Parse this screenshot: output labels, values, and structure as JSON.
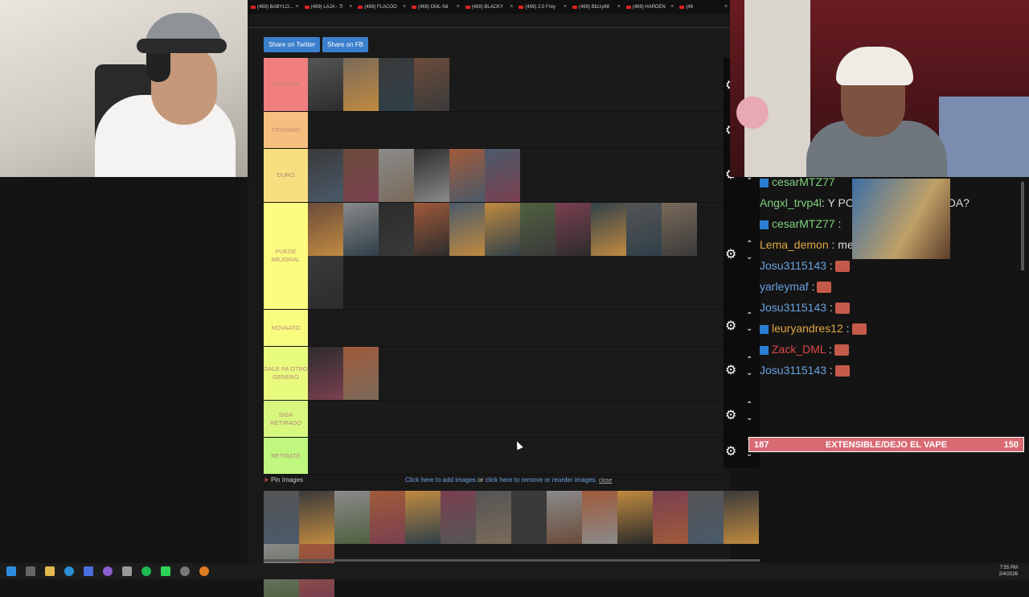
{
  "browser": {
    "tabs": [
      "(469) BABYLO...",
      "(469) LAJA - 7l",
      "(469) FLACOO",
      "(469) DML-Nil",
      "(469) BLACKY",
      "(469) 2.0 Frey",
      "(469) Blizzy68",
      "(469) HARDEN",
      "(46"
    ],
    "share_twitter": "Share on Twitter",
    "share_fb": "Share on FB"
  },
  "tiers": [
    {
      "label": "LEYENDA",
      "color": "#f27f7f",
      "thumb_count": 4
    },
    {
      "label": "TRYHARD",
      "color": "#f7bf7f",
      "thumb_count": 0
    },
    {
      "label": "DURO",
      "color": "#f7df7f",
      "thumb_count": 6
    },
    {
      "label": "PUEDE MEJORAL",
      "color": "#fcfc7f",
      "thumb_count": 12
    },
    {
      "label": "NOVAATO",
      "color": "#f7fc7f",
      "thumb_count": 0
    },
    {
      "label": "DALE PA OTRO GENERO",
      "color": "#e9fb7f",
      "thumb_count": 2
    },
    {
      "label": "SIGA RETIRADO",
      "color": "#d7f77f",
      "thumb_count": 0
    },
    {
      "label": "RETIRATE",
      "color": "#bff77f",
      "thumb_count": 0
    }
  ],
  "pin": {
    "label": "Pin Images",
    "link_add": "Click here to add images",
    "or": " or ",
    "link_remove": "click here to remove or reorder images.",
    "close": "close",
    "thumb_count": 16
  },
  "chat": [
    {
      "user": "cesarMTZ77",
      "text": "",
      "color": "#7fd17f",
      "badge": true,
      "emote": false
    },
    {
      "user": "Angxl_trvp4l",
      "text": ": Y POR ESO ES LEYENDA?",
      "color": "#7fd17f",
      "badge": false,
      "emote": false
    },
    {
      "user": "cesarMTZ77",
      "text": " :",
      "color": "#7fd17f",
      "badge": true,
      "emote": false
    },
    {
      "user": "Lema_demon",
      "text": " : memo o omega?",
      "color": "#e0a642",
      "badge": false,
      "emote": false
    },
    {
      "user": "Josu3115143",
      "text": " :",
      "color": "#6aa2e0",
      "badge": false,
      "emote": true
    },
    {
      "user": "yarleymaf",
      "text": " :",
      "color": "#6aa2e0",
      "badge": false,
      "emote": true
    },
    {
      "user": "Josu3115143",
      "text": " :",
      "color": "#6aa2e0",
      "badge": false,
      "emote": true
    },
    {
      "user": "leuryandres12",
      "text": " :",
      "color": "#e0a642",
      "badge": true,
      "emote": true
    },
    {
      "user": "Zack_DML",
      "text": " :",
      "color": "#e04848",
      "badge": true,
      "emote": true
    },
    {
      "user": "Josu3115143",
      "text": " :",
      "color": "#6aa2e0",
      "badge": false,
      "emote": true
    }
  ],
  "goal": {
    "left": "187",
    "title": "EXTENSIBLE/DEJO EL VAPE",
    "right": "150"
  },
  "taskbar": {
    "time": "7:55 PM",
    "date": "2/4/2026"
  }
}
